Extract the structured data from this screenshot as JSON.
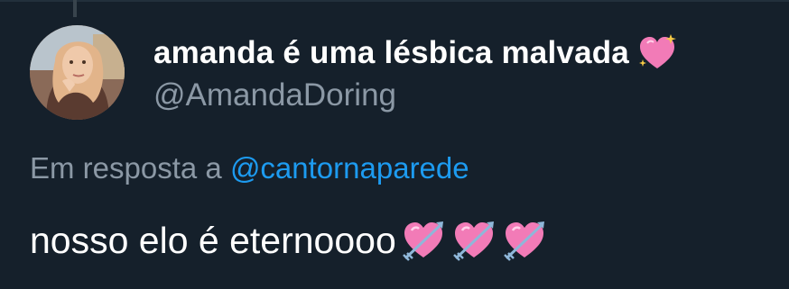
{
  "tweet": {
    "display_name": "amanda é uma lésbica malvada",
    "name_emoji": "sparkling-heart-emoji",
    "handle": "@AmandaDoring",
    "reply_prefix": "Em resposta a ",
    "reply_to": "@cantornaparede",
    "text": "nosso elo é eternoooo",
    "text_emojis": [
      "heart-with-arrow-emoji",
      "heart-with-arrow-emoji",
      "heart-with-arrow-emoji"
    ]
  },
  "colors": {
    "background": "#15202b",
    "primary_text": "#ffffff",
    "secondary_text": "#8b98a5",
    "link": "#1d9bf0",
    "emoji_pink": "#f27bb7"
  }
}
